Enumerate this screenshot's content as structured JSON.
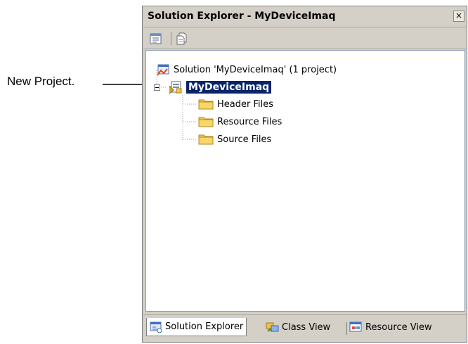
{
  "callout": {
    "label": "New Project."
  },
  "window": {
    "title": "Solution Explorer - MyDeviceImaq",
    "close_glyph": "×"
  },
  "toolbar": {
    "buttons": [
      {
        "icon": "properties-icon"
      },
      {
        "icon": "show-all-files-icon"
      }
    ]
  },
  "tree": {
    "solution": {
      "label": "Solution 'MyDeviceImaq' (1 project)",
      "icon": "solution-icon"
    },
    "project": {
      "label": "MyDeviceImaq",
      "icon": "project-icon",
      "expanded": true,
      "selected": true
    },
    "folders": [
      {
        "label": "Header Files",
        "icon": "folder-icon"
      },
      {
        "label": "Resource Files",
        "icon": "folder-icon"
      },
      {
        "label": "Source Files",
        "icon": "folder-icon"
      }
    ]
  },
  "tabs": [
    {
      "label": "Solution Explorer",
      "icon": "solution-explorer-icon",
      "active": true
    },
    {
      "label": "Class View",
      "icon": "class-view-icon",
      "active": false
    },
    {
      "label": "Resource View",
      "icon": "resource-view-icon",
      "active": false
    }
  ],
  "colors": {
    "selection": "#0a246a",
    "chrome": "#d4d0c8",
    "folder": "#f2c94c"
  }
}
